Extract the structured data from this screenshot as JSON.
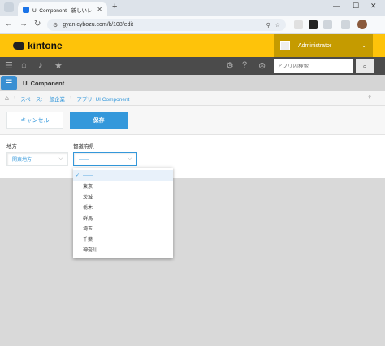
{
  "browser": {
    "tab_title": "UI Component - 新しいレコード",
    "url": "gyan.cybozu.com/k/108/edit"
  },
  "header": {
    "logo": "kintone",
    "user": "Administrator"
  },
  "nav": {
    "search_placeholder": "アプリ内検索"
  },
  "app": {
    "title": "UI Component"
  },
  "breadcrumb": {
    "space": "スペース: 一般企業",
    "app": "アプリ: UI Component"
  },
  "actions": {
    "cancel": "キャンセル",
    "save": "保存"
  },
  "form": {
    "region_label": "地方",
    "region_value": "関東地方",
    "prefecture_label": "都道府県",
    "prefecture_value": "------"
  },
  "dropdown": {
    "items": [
      "------",
      "東京",
      "茨城",
      "栃木",
      "群馬",
      "埼玉",
      "千葉",
      "神奈川"
    ]
  },
  "colors": {
    "brand_yellow": "#fec30a",
    "accent_blue": "#3498db",
    "nav_dark": "#4b4b4b"
  }
}
